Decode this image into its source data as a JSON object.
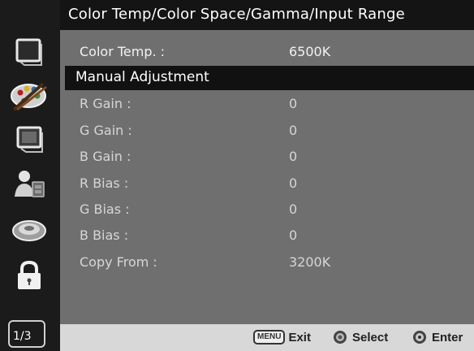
{
  "header": {
    "title": "Color Temp/Color Space/Gamma/Input Range"
  },
  "sidebar": {
    "icons": [
      "monitor-icon",
      "palette-icon",
      "screen-icon",
      "user-tools-icon",
      "joystick-icon",
      "lock-icon"
    ],
    "page_indicator": "1/3"
  },
  "menu": {
    "rows": [
      {
        "label": "Color Temp. :",
        "value": "6500K"
      },
      {
        "label": "Manual Adjustment",
        "value": ""
      },
      {
        "label": "R Gain :",
        "value": "0"
      },
      {
        "label": "G Gain :",
        "value": "0"
      },
      {
        "label": "B Gain :",
        "value": "0"
      },
      {
        "label": "R Bias :",
        "value": "0"
      },
      {
        "label": "G Bias :",
        "value": "0"
      },
      {
        "label": "B Bias :",
        "value": "0"
      },
      {
        "label": "Copy From :",
        "value": "3200K"
      }
    ]
  },
  "footer": {
    "menu_key": "MENU",
    "exit_label": "Exit",
    "select_label": "Select",
    "enter_label": "Enter"
  },
  "colors": {
    "sidebar_bg": "#1b1b1b",
    "header_bg": "#141414",
    "menu_bg": "#6f6f6f",
    "highlight_bg": "#111111",
    "footer_bg": "#d8d8d8"
  }
}
